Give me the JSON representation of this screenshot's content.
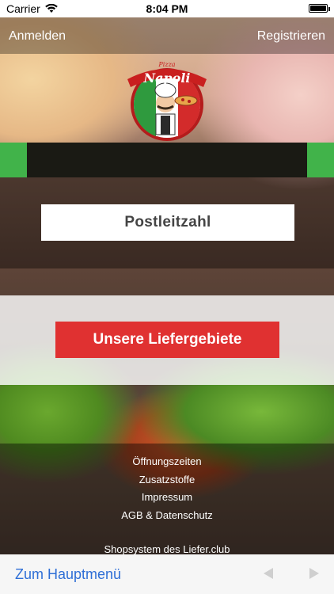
{
  "status_bar": {
    "carrier": "Carrier",
    "time": "8:04 PM"
  },
  "header": {
    "login": "Anmelden",
    "register": "Registrieren"
  },
  "logo": {
    "text_top": "Pizza",
    "text_main": "Napoli"
  },
  "postcode": {
    "label": "Postleitzahl"
  },
  "delivery_button": {
    "label": "Unsere Liefergebiete"
  },
  "footer": {
    "links": [
      "Öffnungszeiten",
      "Zusatzstoffe",
      "Impressum",
      "AGB & Datenschutz"
    ],
    "shopsystem": "Shopsystem des Liefer.club"
  },
  "toolbar": {
    "home": "Zum Hauptmenü"
  },
  "colors": {
    "accent_red": "#e03131",
    "accent_green": "#41b34a",
    "link_blue": "#2f6fd6"
  }
}
